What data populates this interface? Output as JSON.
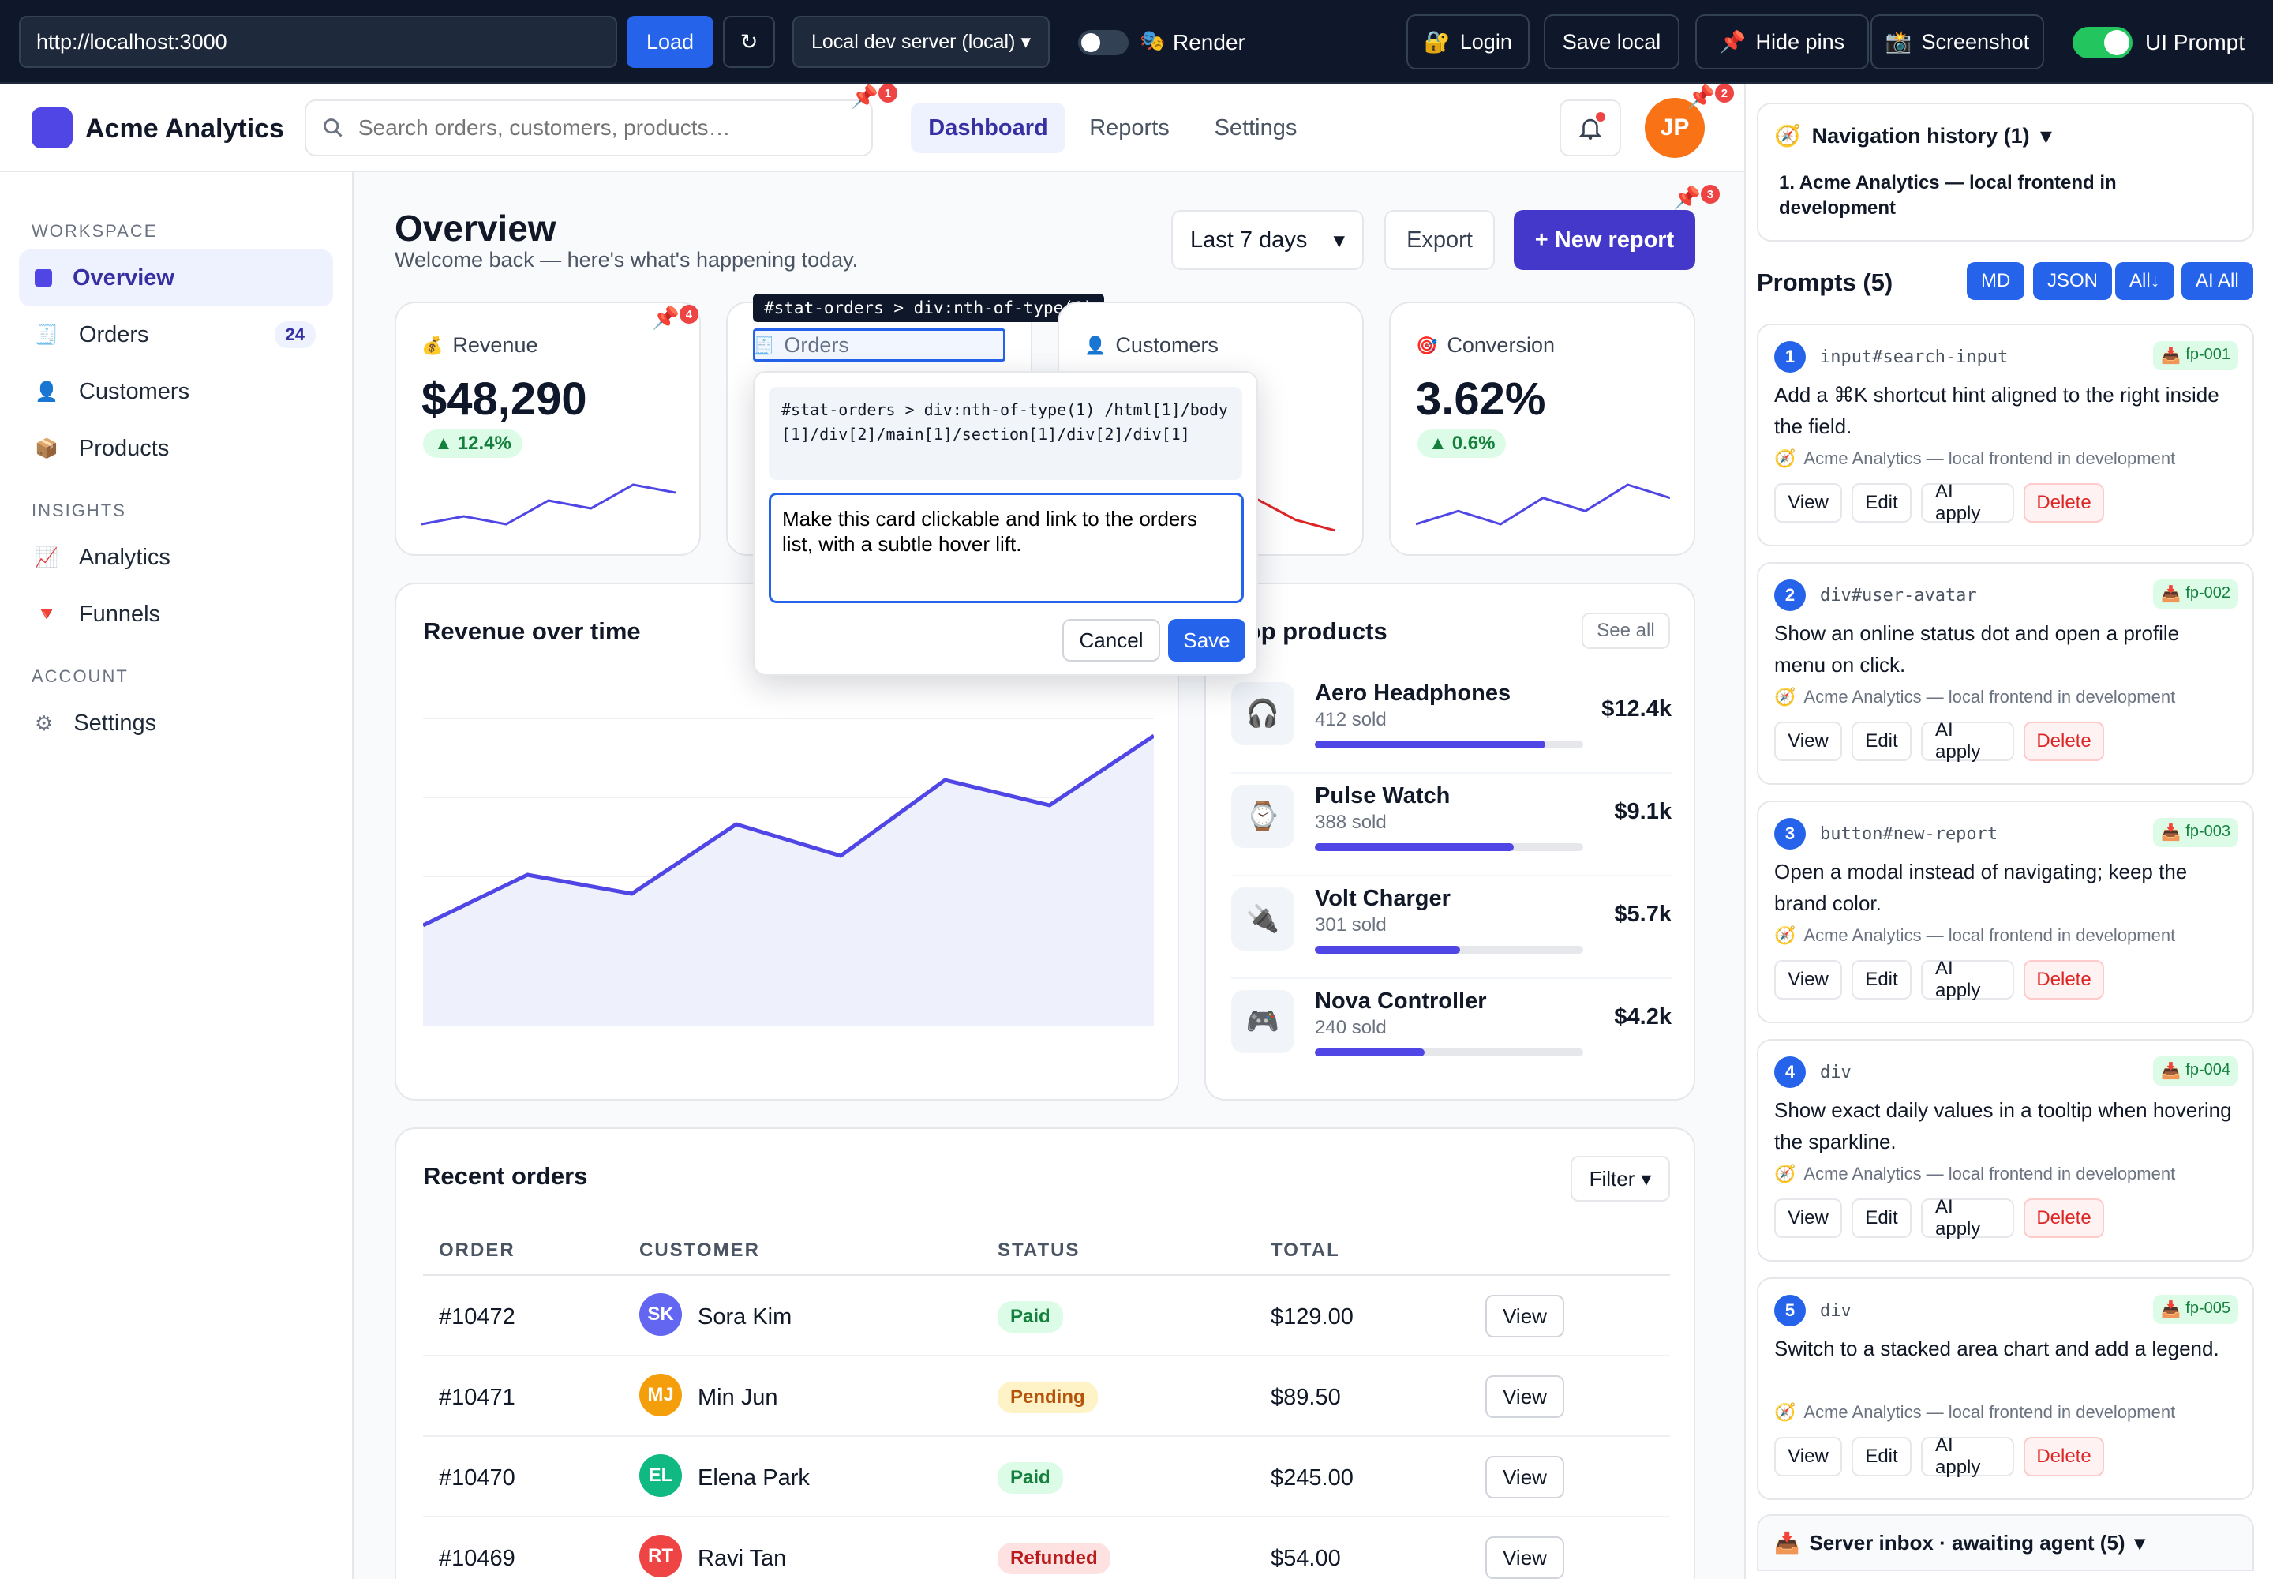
{
  "toolbar": {
    "url_value": "http://localhost:3000",
    "load_label": "Load",
    "refresh_glyph": "↻",
    "server_option": "Local dev server (local)",
    "render_label": "Render",
    "login_label": "Login",
    "save_local_label": "Save local",
    "hide_pins_label": "Hide pins",
    "screenshot_label": "Screenshot",
    "ui_prompt_label": "UI Prompt"
  },
  "app": {
    "brand": "Acme Analytics",
    "search_placeholder": "Search orders, customers, products…",
    "tabs": [
      "Dashboard",
      "Reports",
      "Settings"
    ],
    "user_initials": "JP",
    "accent": "#4f46e5"
  },
  "sidebar": {
    "sections": [
      {
        "title": "WORKSPACE",
        "items": [
          {
            "label": "Overview",
            "icon": "square-icon",
            "glyph": "■"
          },
          {
            "label": "Orders",
            "icon": "receipt-icon",
            "glyph": "🧾",
            "count": "24"
          },
          {
            "label": "Customers",
            "icon": "user-icon",
            "glyph": "👤"
          },
          {
            "label": "Products",
            "icon": "box-icon",
            "glyph": "📦"
          }
        ]
      },
      {
        "title": "INSIGHTS",
        "items": [
          {
            "label": "Analytics",
            "icon": "chart-icon",
            "glyph": "📈"
          },
          {
            "label": "Funnels",
            "icon": "funnel-icon",
            "glyph": "🔻"
          }
        ]
      },
      {
        "title": "ACCOUNT",
        "items": [
          {
            "label": "Settings",
            "icon": "gear-icon",
            "glyph": "⚙"
          }
        ]
      }
    ]
  },
  "overview": {
    "title": "Overview",
    "subtitle": "Welcome back — here's what's happening today.",
    "range": "Last 7 days",
    "export_label": "Export",
    "new_report_label": "+ New report"
  },
  "stats": [
    {
      "label": "Revenue",
      "value": "$48,290",
      "delta": "12.4%",
      "icon": "money-bag-icon",
      "glyph": "💰"
    },
    {
      "label": "Orders",
      "icon": "receipt-icon",
      "glyph": "🧾"
    },
    {
      "label": "Customers",
      "icon": "user-icon",
      "glyph": "👤"
    },
    {
      "label": "Conversion",
      "value": "3.62%",
      "delta": "0.6%",
      "icon": "target-icon",
      "glyph": "🎯"
    }
  ],
  "sparklines": {
    "revenue": [
      5,
      6,
      5,
      8,
      7,
      10,
      9
    ],
    "conversion": [
      4,
      5,
      4,
      6,
      5,
      7,
      6
    ],
    "customers_tail": [
      6,
      4,
      3
    ]
  },
  "inspector": {
    "selector_tag": "#stat-orders > div:nth-of-type(1)",
    "path": "#stat-orders > div:nth-of-type(1) /html[1]/body[1]/div[2]/main[1]/section[1]/div[2]/div[1]",
    "prompt_value": "Make this card clickable and link to the orders list, with a subtle hover lift.",
    "cancel_label": "Cancel",
    "save_label": "Save"
  },
  "revenue_chart": {
    "title": "Revenue over time",
    "chart_data": {
      "type": "area",
      "title": "Revenue over time",
      "x": [
        1,
        2,
        3,
        4,
        5,
        6,
        7,
        8
      ],
      "values": [
        32,
        48,
        42,
        64,
        54,
        78,
        70,
        92
      ],
      "ylim": [
        0,
        110
      ],
      "grid": true
    }
  },
  "top_products": {
    "title": "Top products",
    "see_all": "See all",
    "items": [
      {
        "name": "Aero Headphones",
        "sold": "412 sold",
        "revenue": "$12.4k",
        "share": 0.86,
        "icon": "headphones-icon",
        "glyph": "🎧"
      },
      {
        "name": "Pulse Watch",
        "sold": "388 sold",
        "revenue": "$9.1k",
        "share": 0.74,
        "icon": "watch-icon",
        "glyph": "⌚"
      },
      {
        "name": "Volt Charger",
        "sold": "301 sold",
        "revenue": "$5.7k",
        "share": 0.54,
        "icon": "plug-icon",
        "glyph": "🔌"
      },
      {
        "name": "Nova Controller",
        "sold": "240 sold",
        "revenue": "$4.2k",
        "share": 0.41,
        "icon": "gamepad-icon",
        "glyph": "🎮"
      }
    ]
  },
  "orders": {
    "title": "Recent orders",
    "filter_label": "Filter",
    "columns": [
      "ORDER",
      "CUSTOMER",
      "STATUS",
      "TOTAL"
    ],
    "view_label": "View",
    "rows": [
      {
        "id": "#10472",
        "initials": "SK",
        "customer": "Sora Kim",
        "status": "Paid",
        "total": "$129.00",
        "avatar_color": "#6366f1"
      },
      {
        "id": "#10471",
        "initials": "MJ",
        "customer": "Min Jun",
        "status": "Pending",
        "total": "$89.50",
        "avatar_color": "#f59e0b"
      },
      {
        "id": "#10470",
        "initials": "EL",
        "customer": "Elena Park",
        "status": "Paid",
        "total": "$245.00",
        "avatar_color": "#10b981"
      },
      {
        "id": "#10469",
        "initials": "RT",
        "customer": "Ravi Tan",
        "status": "Refunded",
        "total": "$54.00",
        "avatar_color": "#ef4444"
      }
    ]
  },
  "panel": {
    "nav_history_title": "Navigation history (1)",
    "nav_history_item": "1. Acme Analytics — local frontend in development",
    "prompts_title": "Prompts (5)",
    "chips": [
      "MD",
      "JSON",
      "All↓",
      "AI All"
    ],
    "prompts": [
      {
        "n": "1",
        "selector": "input#search-input",
        "tag": "fp-001",
        "text": "Add a ⌘K shortcut hint aligned to the right inside the field.",
        "meta": "Acme Analytics — local frontend in development"
      },
      {
        "n": "2",
        "selector": "div#user-avatar",
        "tag": "fp-002",
        "text": "Show an online status dot and open a profile menu on click.",
        "meta": "Acme Analytics — local frontend in development"
      },
      {
        "n": "3",
        "selector": "button#new-report",
        "tag": "fp-003",
        "text": "Open a modal instead of navigating; keep the brand color.",
        "meta": "Acme Analytics — local frontend in development"
      },
      {
        "n": "4",
        "selector": "div",
        "tag": "fp-004",
        "text": "Show exact daily values in a tooltip when hovering the sparkline.",
        "meta": "Acme Analytics — local frontend in development"
      },
      {
        "n": "5",
        "selector": "div",
        "tag": "fp-005",
        "text": "Switch to a stacked area chart and add a legend.",
        "meta": "Acme Analytics — local frontend in development"
      }
    ],
    "prompt_actions": [
      "View",
      "Edit",
      "AI apply",
      "Delete"
    ],
    "inbox_title": "Server inbox · awaiting agent (5)"
  },
  "pins": [
    "1",
    "2",
    "3",
    "4"
  ]
}
